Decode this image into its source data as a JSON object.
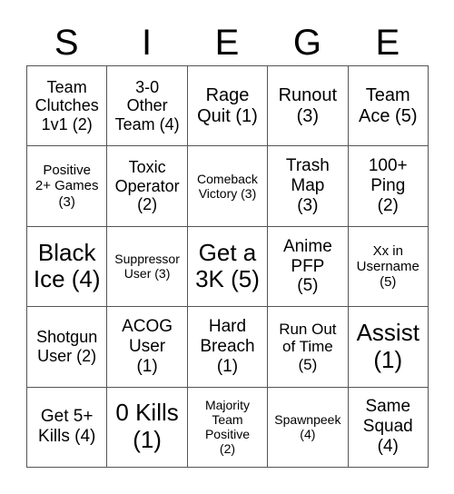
{
  "title_letters": [
    "S",
    "I",
    "E",
    "G",
    "E"
  ],
  "cells": [
    "Team\nClutches\n1v1 (2)",
    "3-0\nOther\nTeam (4)",
    "Rage\nQuit (1)",
    "Runout\n(3)",
    "Team\nAce (5)",
    "Positive\n2+ Games\n(3)",
    "Toxic\nOperator\n(2)",
    "Comeback\nVictory (3)",
    "Trash\nMap\n(3)",
    "100+\nPing\n(2)",
    "Black\nIce (4)",
    "Suppressor\nUser (3)",
    "Get a\n3K (5)",
    "Anime\nPFP\n(5)",
    "Xx in\nUsername\n(5)",
    "Shotgun\nUser (2)",
    "ACOG\nUser\n(1)",
    "Hard\nBreach\n(1)",
    "Run Out\nof Time\n(5)",
    "Assist\n(1)",
    "Get 5+\nKills (4)",
    "0 Kills\n(1)",
    "Majority\nTeam\nPositive\n(2)",
    "Spawnpeek\n(4)",
    "Same\nSquad\n(4)"
  ]
}
